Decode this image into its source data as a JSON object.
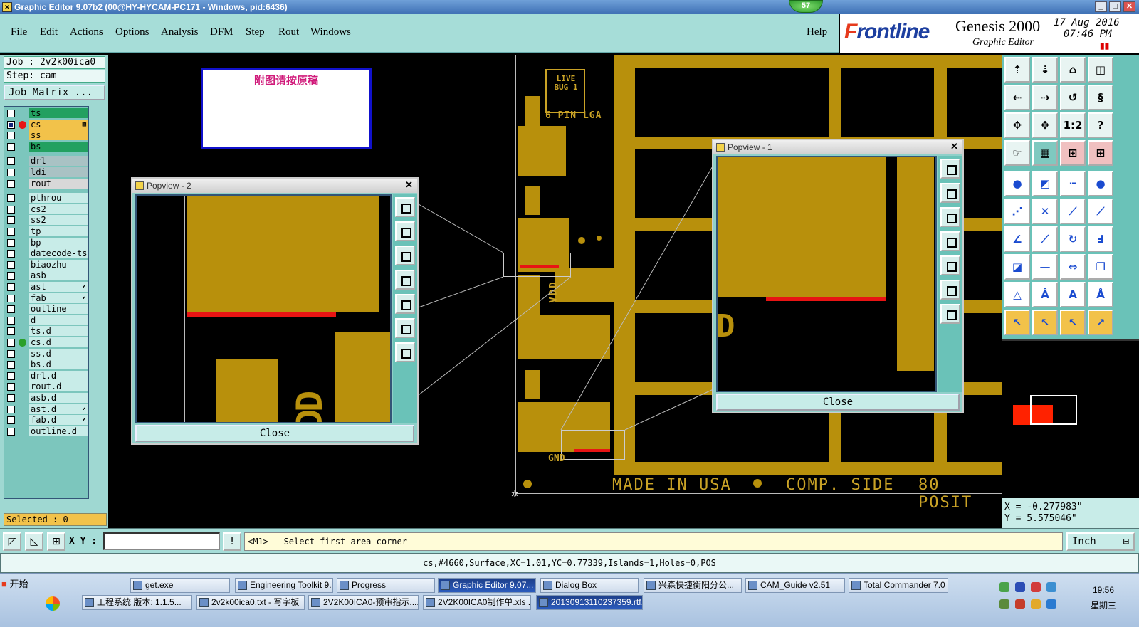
{
  "window": {
    "title": "Graphic Editor 9.07b2 (00@HY-HYCAM-PC171 - Windows, pid:6436)",
    "badge": "57",
    "minimize": "_",
    "restore": "□",
    "close": "✕"
  },
  "menu": [
    "File",
    "Edit",
    "Actions",
    "Options",
    "Analysis",
    "DFM",
    "Step",
    "Rout",
    "Windows"
  ],
  "help": "Help",
  "brand": {
    "logo_f": "F",
    "logo_rest": "rontline",
    "product": "Genesis 2000",
    "subtitle": "Graphic Editor",
    "date": "17 Aug 2016",
    "time": "07:46 PM",
    "pause": "▮▮"
  },
  "job": {
    "job": "Job : 2v2k00ica0",
    "step": "Step: cam",
    "matrix": "Job Matrix ..."
  },
  "layers": [
    {
      "name": "ts",
      "color": "#22a060",
      "check": false,
      "dot": ""
    },
    {
      "name": "cs",
      "color": "#f2c24a",
      "check": true,
      "dot": "#e81414",
      "mark": "▩"
    },
    {
      "name": "ss",
      "color": "#f2c24a",
      "check": false,
      "dot": ""
    },
    {
      "name": "bs",
      "color": "#22a060",
      "check": false,
      "dot": ""
    },
    {
      "name": "drl",
      "color": "#a9c2c4",
      "check": false,
      "dot": ""
    },
    {
      "name": "ldi",
      "color": "#a9c2c4",
      "check": false,
      "dot": ""
    },
    {
      "name": "rout",
      "color": "#d8d8d8",
      "check": false,
      "dot": ""
    },
    {
      "name": "pthrou",
      "color": "#c8ece8",
      "check": false,
      "dot": ""
    },
    {
      "name": "cs2",
      "color": "#c8ece8",
      "check": false,
      "dot": ""
    },
    {
      "name": "ss2",
      "color": "#c8ece8",
      "check": false,
      "dot": ""
    },
    {
      "name": "tp",
      "color": "#c8ece8",
      "check": false,
      "dot": ""
    },
    {
      "name": "bp",
      "color": "#c8ece8",
      "check": false,
      "dot": ""
    },
    {
      "name": "datecode-ts",
      "color": "#c8ece8",
      "check": false,
      "dot": ""
    },
    {
      "name": "biaozhu",
      "color": "#c8ece8",
      "check": false,
      "dot": ""
    },
    {
      "name": "asb",
      "color": "#c8ece8",
      "check": false,
      "dot": ""
    },
    {
      "name": "ast",
      "color": "#c8ece8",
      "check": false,
      "dot": "",
      "mark": "⬋"
    },
    {
      "name": "fab",
      "color": "#c8ece8",
      "check": false,
      "dot": "",
      "mark": "⬋"
    },
    {
      "name": "outline",
      "color": "#c8ece8",
      "check": false,
      "dot": ""
    },
    {
      "name": "d",
      "color": "#c8ece8",
      "check": false,
      "dot": ""
    },
    {
      "name": "ts.d",
      "color": "#c8ece8",
      "check": false,
      "dot": ""
    },
    {
      "name": "cs.d",
      "color": "#c8ece8",
      "check": false,
      "dot": "#2aa02a"
    },
    {
      "name": "ss.d",
      "color": "#c8ece8",
      "check": false,
      "dot": ""
    },
    {
      "name": "bs.d",
      "color": "#c8ece8",
      "check": false,
      "dot": ""
    },
    {
      "name": "drl.d",
      "color": "#c8ece8",
      "check": false,
      "dot": ""
    },
    {
      "name": "rout.d",
      "color": "#c8ece8",
      "check": false,
      "dot": ""
    },
    {
      "name": "asb.d",
      "color": "#c8ece8",
      "check": false,
      "dot": ""
    },
    {
      "name": "ast.d",
      "color": "#c8ece8",
      "check": false,
      "dot": "",
      "mark": "⬋"
    },
    {
      "name": "fab.d",
      "color": "#c8ece8",
      "check": false,
      "dot": "",
      "mark": "⬋"
    },
    {
      "name": "outline.d",
      "color": "#c8ece8",
      "check": false,
      "dot": ""
    }
  ],
  "selected": "Selected : 0",
  "board": {
    "note": "附图请按原稿",
    "silk_bug": "LIVE BUG 1",
    "silk_pin": "6 PIN LGA",
    "silk_vdd": "VDD",
    "silk_gnd": "GND",
    "silk_made": "MADE IN USA",
    "silk_comp": "COMP. SIDE",
    "silk_posit": "80 POSIT",
    "silk_d1": "D",
    "silk_dd": "DD"
  },
  "popview1": {
    "title": "Popview - 1",
    "close": "Close",
    "x": "✕"
  },
  "popview2": {
    "title": "Popview - 2",
    "close": "Close",
    "x": "✕"
  },
  "coords": {
    "x": "X = -0.277983\"",
    "y": "Y = 5.575046\""
  },
  "cmd": {
    "xy_label": "X Y :",
    "xy_value": "",
    "prompt": "<M1> - Select first area corner",
    "units": "Inch",
    "info": "!"
  },
  "status": "cs,#4660,Surface,XC=1.01,YC=0.77339,Islands=1,Holes=0,POS",
  "taskbar": {
    "start": "开始",
    "row1": [
      "get.exe",
      "Engineering Toolkit 9....",
      "Progress",
      "Graphic Editor 9.07...",
      "Dialog Box",
      "兴森快捷衡阳分公...",
      "CAM_Guide v2.51",
      "Total Commander 7.0 ..."
    ],
    "row2": [
      "工程系统  版本: 1.1.5...",
      "2v2k00ica0.txt - 写字板",
      "2V2K00ICA0-预审指示....",
      "2V2K00ICA0制作单.xls  ...",
      "20130913110237359.rtf..."
    ],
    "clock_time": "19:56",
    "clock_day": "星期三"
  },
  "colors": {
    "copper": "#b8900c",
    "panel": "#a6ddd8",
    "accent": "#e81414"
  }
}
